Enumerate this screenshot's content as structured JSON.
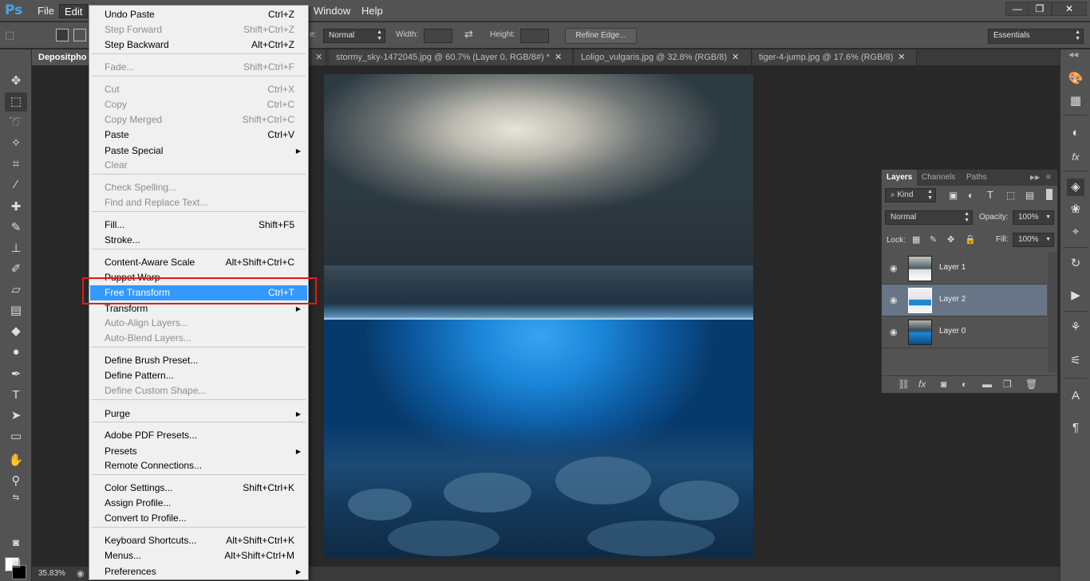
{
  "app": {
    "logo": "Ps"
  },
  "menubar": {
    "items": [
      "File",
      "Edit",
      "Window",
      "Help"
    ]
  },
  "window_controls": {
    "minimize": "—",
    "restore": "❐",
    "close": "✕"
  },
  "options": {
    "style_label": "e:",
    "style_value": "Normal",
    "width_label": "Width:",
    "height_label": "Height:",
    "refine_edge": "Refine Edge...",
    "workspace": "Essentials"
  },
  "tabs": [
    {
      "label": "Depositpho"
    },
    {
      "label": "stormy_sky-1472045.jpg @ 60.7% (Layer 0, RGB/8#) *"
    },
    {
      "label": "Loligo_vulgaris.jpg @ 32.8% (RGB/8)"
    },
    {
      "label": "tiger-4-jump.jpg @ 17.6% (RGB/8)"
    }
  ],
  "status": {
    "zoom": "35.83%"
  },
  "edit_menu": {
    "items": [
      {
        "label": "Undo Paste",
        "shortcut": "Ctrl+Z",
        "disabled": false
      },
      {
        "label": "Step Forward",
        "shortcut": "Shift+Ctrl+Z",
        "disabled": true
      },
      {
        "label": "Step Backward",
        "shortcut": "Alt+Ctrl+Z",
        "disabled": false
      },
      {
        "label": "Fade...",
        "shortcut": "Shift+Ctrl+F",
        "disabled": true
      },
      {
        "label": "Cut",
        "shortcut": "Ctrl+X",
        "disabled": true
      },
      {
        "label": "Copy",
        "shortcut": "Ctrl+C",
        "disabled": true
      },
      {
        "label": "Copy Merged",
        "shortcut": "Shift+Ctrl+C",
        "disabled": true
      },
      {
        "label": "Paste",
        "shortcut": "Ctrl+V",
        "disabled": false
      },
      {
        "label": "Paste Special",
        "shortcut": "",
        "disabled": false,
        "submenu": true
      },
      {
        "label": "Clear",
        "shortcut": "",
        "disabled": true
      },
      {
        "label": "Check Spelling...",
        "shortcut": "",
        "disabled": true
      },
      {
        "label": "Find and Replace Text...",
        "shortcut": "",
        "disabled": true
      },
      {
        "label": "Fill...",
        "shortcut": "Shift+F5",
        "disabled": false
      },
      {
        "label": "Stroke...",
        "shortcut": "",
        "disabled": false
      },
      {
        "label": "Content-Aware Scale",
        "shortcut": "Alt+Shift+Ctrl+C",
        "disabled": false
      },
      {
        "label": "Puppet Warp",
        "shortcut": "",
        "disabled": false
      },
      {
        "label": "Free Transform",
        "shortcut": "Ctrl+T",
        "disabled": false,
        "highlighted": true
      },
      {
        "label": "Transform",
        "shortcut": "",
        "disabled": false,
        "submenu": true
      },
      {
        "label": "Auto-Align Layers...",
        "shortcut": "",
        "disabled": true
      },
      {
        "label": "Auto-Blend Layers...",
        "shortcut": "",
        "disabled": true
      },
      {
        "label": "Define Brush Preset...",
        "shortcut": "",
        "disabled": false
      },
      {
        "label": "Define Pattern...",
        "shortcut": "",
        "disabled": false
      },
      {
        "label": "Define Custom Shape...",
        "shortcut": "",
        "disabled": true
      },
      {
        "label": "Purge",
        "shortcut": "",
        "disabled": false,
        "submenu": true
      },
      {
        "label": "Adobe PDF Presets...",
        "shortcut": "",
        "disabled": false
      },
      {
        "label": "Presets",
        "shortcut": "",
        "disabled": false,
        "submenu": true
      },
      {
        "label": "Remote Connections...",
        "shortcut": "",
        "disabled": false
      },
      {
        "label": "Color Settings...",
        "shortcut": "Shift+Ctrl+K",
        "disabled": false
      },
      {
        "label": "Assign Profile...",
        "shortcut": "",
        "disabled": false
      },
      {
        "label": "Convert to Profile...",
        "shortcut": "",
        "disabled": false
      },
      {
        "label": "Keyboard Shortcuts...",
        "shortcut": "Alt+Shift+Ctrl+K",
        "disabled": false
      },
      {
        "label": "Menus...",
        "shortcut": "Alt+Shift+Ctrl+M",
        "disabled": false
      },
      {
        "label": "Preferences",
        "shortcut": "",
        "disabled": false,
        "submenu": true
      }
    ],
    "submenu_arrow": "▶"
  },
  "layers_panel": {
    "tabs": [
      "Layers",
      "Channels",
      "Paths"
    ],
    "filter_kind": "Kind",
    "blend_mode": "Normal",
    "opacity_label": "Opacity:",
    "opacity_value": "100%",
    "lock_label": "Lock:",
    "fill_label": "Fill:",
    "fill_value": "100%",
    "layers": [
      {
        "name": "Layer 1",
        "selected": false
      },
      {
        "name": "Layer 2",
        "selected": true
      },
      {
        "name": "Layer 0",
        "selected": false
      }
    ],
    "eye": "👁"
  },
  "colors": {
    "menu_highlight": "#3399ff",
    "annotation_box": "#e21b1b",
    "selected_layer": "#677587"
  }
}
